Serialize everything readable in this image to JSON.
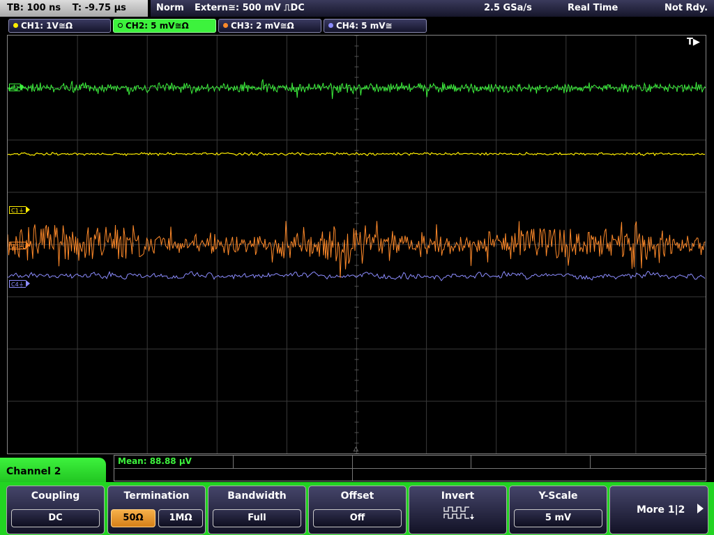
{
  "status": {
    "timebase": "TB: 100 ns",
    "trigger_time": "T: -9.75 µs",
    "trigger_mode": "Norm",
    "trigger_source": "Extern≅: 500 mV ⎍DC",
    "sample_rate": "2.5 GSa/s",
    "acq_mode": "Real Time",
    "acq_state": "Not Rdy."
  },
  "channels": [
    {
      "label": "CH1: 1V≅Ω",
      "color": "#ffee00",
      "marker": "C1⏚"
    },
    {
      "label": "CH2: 5 mV≅Ω",
      "color": "#3df23d",
      "marker": "C2"
    },
    {
      "label": "CH3: 2 mV≅Ω",
      "color": "#ff8a2a",
      "marker": "C3⏚"
    },
    {
      "label": "CH4: 5 mV≅",
      "color": "#8c8cff",
      "marker": "C4⏚"
    }
  ],
  "plot": {
    "trigger_marker": "T▶",
    "trigger_position": "△"
  },
  "measurement": {
    "mean": "Mean: 88.88 µV"
  },
  "menu": {
    "title": "Channel 2",
    "coupling": {
      "title": "Coupling",
      "value": "DC"
    },
    "termination": {
      "title": "Termination",
      "options": [
        "50Ω",
        "1MΩ"
      ],
      "selected": 0
    },
    "bandwidth": {
      "title": "Bandwidth",
      "value": "Full"
    },
    "offset": {
      "title": "Offset",
      "value": "Off"
    },
    "invert": {
      "title": "Invert",
      "icon": "invert-waveform-icon"
    },
    "yscale": {
      "title": "Y-Scale",
      "value": "5 mV"
    },
    "more": {
      "label": "More 1|2",
      "icon": "arrow-right-icon"
    }
  }
}
